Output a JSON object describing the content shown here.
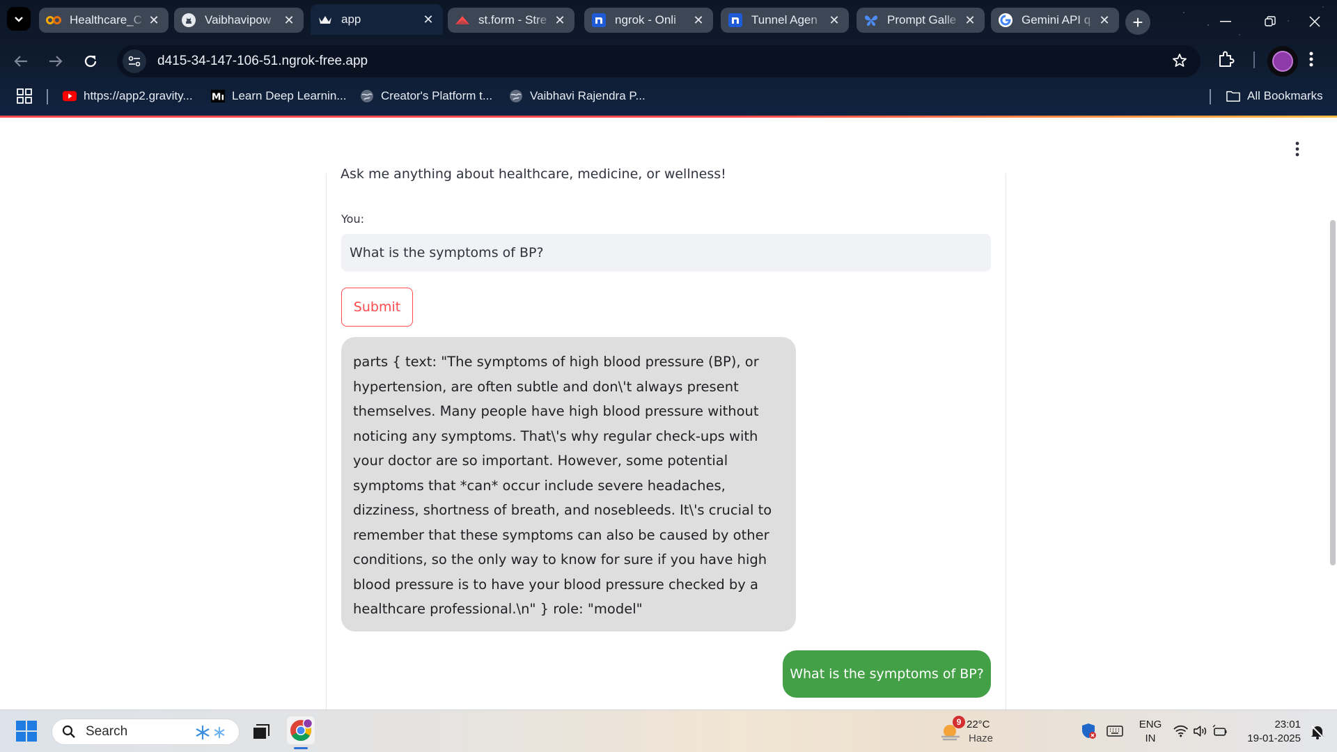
{
  "browser": {
    "tabs": [
      {
        "title": "Healthcare_C",
        "icon": "colab-icon",
        "active": false
      },
      {
        "title": "Vaibhavipow",
        "icon": "github-icon",
        "active": false
      },
      {
        "title": "app",
        "icon": "streamlit-crown-icon",
        "active": true
      },
      {
        "title": "st.form - Stre",
        "icon": "streamlit-icon",
        "active": false
      },
      {
        "title": "ngrok - Onli",
        "icon": "ngrok-icon",
        "active": false
      },
      {
        "title": "Tunnel Agen",
        "icon": "ngrok-icon",
        "active": false
      },
      {
        "title": "Prompt Galle",
        "icon": "google-ai-icon",
        "active": false
      },
      {
        "title": "Gemini API q",
        "icon": "google-icon",
        "active": false
      }
    ],
    "url": "d415-34-147-106-51.ngrok-free.app",
    "bookmarks": [
      {
        "label": "https://app2.gravity...",
        "icon": "youtube-icon"
      },
      {
        "label": "Learn Deep Learnin...",
        "icon": "medium-icon"
      },
      {
        "label": "Creator's Platform t...",
        "icon": "globe-icon"
      },
      {
        "label": "Vaibhavi Rajendra P...",
        "icon": "globe-icon"
      }
    ],
    "all_bookmarks": "All Bookmarks"
  },
  "app": {
    "intro": "Ask me anything about healthcare, medicine, or wellness!",
    "input_label": "You:",
    "input_value": "What is the symptoms of BP?",
    "submit_label": "Submit",
    "messages": [
      {
        "role": "bot",
        "text": "parts { text: \"The symptoms of high blood pressure (BP), or hypertension, are often subtle and don\\'t always present themselves. Many people have high blood pressure without noticing any symptoms. That\\'s why regular check-ups with your doctor are so important. However, some potential symptoms that *can* occur include severe headaches, dizziness, shortness of breath, and nosebleeds. It\\'s crucial to remember that these symptoms can also be caused by other conditions, so the only way to know for sure if you have high blood pressure is to have your blood pressure checked by a healthcare professional.\\n\" } role: \"model\""
      },
      {
        "role": "user",
        "text": "What is the symptoms of BP?"
      }
    ],
    "colors": {
      "accent": "#ff4b4b",
      "user_bubble": "#43a047",
      "bot_bubble": "#dedede"
    }
  },
  "taskbar": {
    "search_placeholder": "Search",
    "weather": {
      "temp": "22°C",
      "condition": "Haze",
      "badge": "9"
    },
    "language": {
      "line1": "ENG",
      "line2": "IN"
    },
    "time": "23:01",
    "date": "19-01-2025"
  }
}
